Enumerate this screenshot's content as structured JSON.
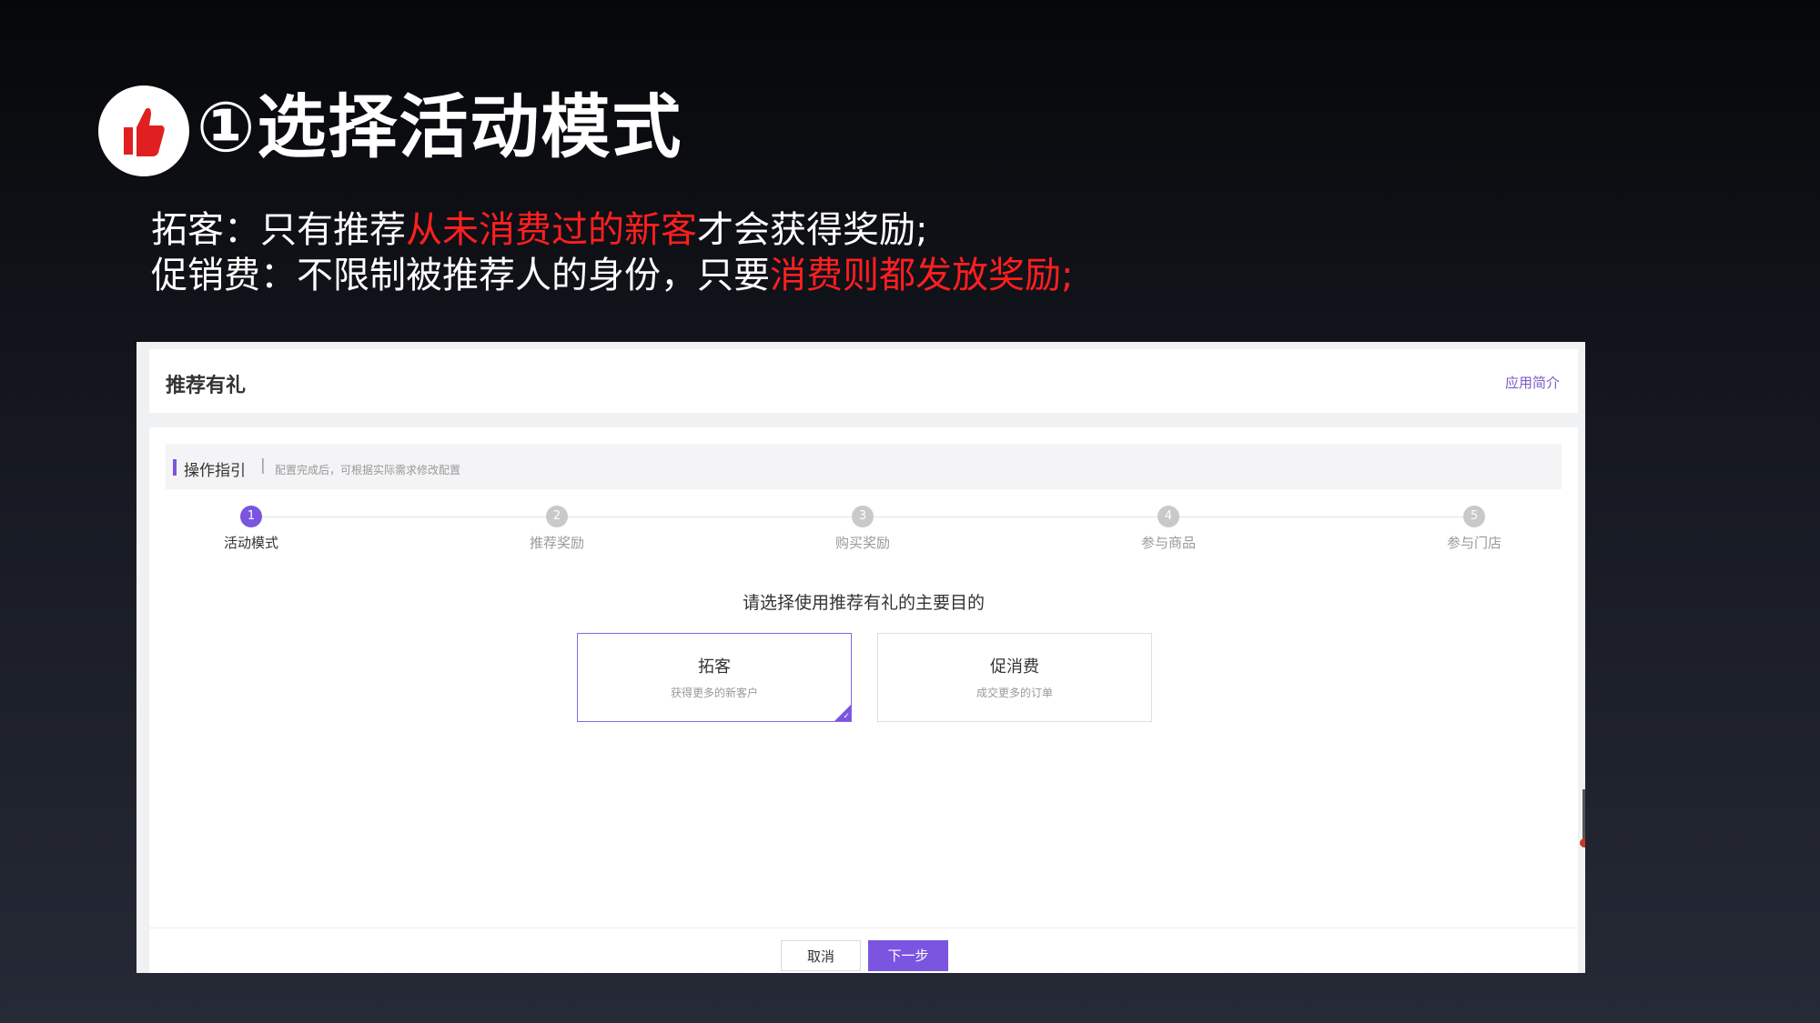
{
  "slide": {
    "icon": "thumbs-up-icon",
    "title": "①选择活动模式",
    "desc_line1": {
      "prefix": "拓客：只有推荐",
      "highlight": "从未消费过的新客",
      "suffix": "才会获得奖励;"
    },
    "desc_line2": {
      "prefix": "促销费：不限制被推荐人的身份，只要",
      "highlight": "消费则都发放奖励;"
    }
  },
  "app": {
    "title": "推荐有礼",
    "intro_link": "应用简介",
    "guide": {
      "title": "操作指引",
      "separator": "|",
      "hint": "配置完成后，可根据实际需求修改配置"
    },
    "steps": [
      {
        "num": "1",
        "label": "活动模式",
        "active": true
      },
      {
        "num": "2",
        "label": "推荐奖励",
        "active": false
      },
      {
        "num": "3",
        "label": "购买奖励",
        "active": false
      },
      {
        "num": "4",
        "label": "参与商品",
        "active": false
      },
      {
        "num": "5",
        "label": "参与门店",
        "active": false
      }
    ],
    "question": "请选择使用推荐有礼的主要目的",
    "cards": [
      {
        "title": "拓客",
        "subtitle": "获得更多的新客户",
        "selected": true
      },
      {
        "title": "促消费",
        "subtitle": "成交更多的订单",
        "selected": false
      }
    ],
    "buttons": {
      "cancel": "取消",
      "next": "下一步"
    }
  },
  "colors": {
    "accent": "#7b55e0",
    "highlight_red": "#ff1f1f",
    "icon_red": "#e02020"
  }
}
